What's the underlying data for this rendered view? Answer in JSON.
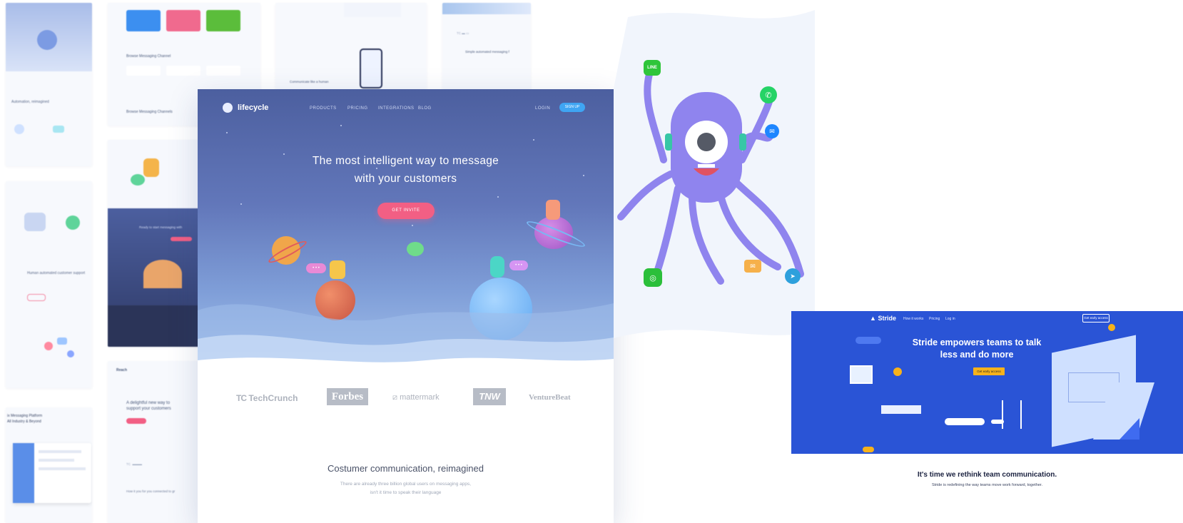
{
  "lifecycle": {
    "brand": "lifecycle",
    "nav": [
      "PRODUCTS",
      "PRICING",
      "INTEGRATIONS",
      "BLOG"
    ],
    "nav_right": {
      "login": "LOGIN",
      "signup": "SIGN UP"
    },
    "hero_line1": "The most intelligent way to message",
    "hero_line2": "with your customers",
    "cta": "GET INVITE",
    "bubble_left": "• • •",
    "bubble_right": "• • •",
    "logos": [
      "TechCrunch",
      "Forbes",
      "mattermark",
      "TNW",
      "VentureBeat"
    ],
    "section_title": "Costumer communication, reimagined",
    "section_sub_line1": "There are already three billion global users on messaging apps,",
    "section_sub_line2": "isn't it time to speak their language"
  },
  "collage": {
    "col_b_section": "Browse Messaging Channel",
    "col_b_footer": "Browse Messaging Channels",
    "col_c_phone_caption": "Communicate like a human",
    "col_d_heading": "Simple automated messaging f",
    "col_a_heading": "Automation, reimagined",
    "col_a_item": "Human automated customer support",
    "col_a_bottom": "ix Messaging Platform\nAll Industry & Beyond",
    "col_b_mid": "Ready to start messaging with",
    "col_b_bottom_brand": "Reach",
    "col_b_bottom_text_1": "A delightful new way to",
    "col_b_bottom_text_2": "support your customers",
    "col_b_bottom_caption": "How it you for you connected to gr",
    "footer_heading": "Reach"
  },
  "octopus": {
    "line_badge": "LINE"
  },
  "stride": {
    "brand": "Stride",
    "nav": [
      "How it works",
      "Pricing",
      "Log in"
    ],
    "nav_button": "Get early access",
    "headline_line1": "Stride empowers teams to talk",
    "headline_line2": "less and do more",
    "cta": "Get early access",
    "below_title": "It's time we rethink team communication.",
    "below_sub": "Stride is redefining the way teams move work forward, together."
  },
  "colors": {
    "lifecycle_hero_top": "#4c5f9f",
    "lifecycle_cta": "#f25f84",
    "lifecycle_signup": "#3fa5f3",
    "octopus": "#8f84ee",
    "stride_bg": "#2a54d6",
    "stride_cta": "#f7b21b",
    "whatsapp": "#25d366",
    "line": "#2fc53a",
    "messenger": "#1e86ff",
    "telegram": "#2ea0dc"
  }
}
